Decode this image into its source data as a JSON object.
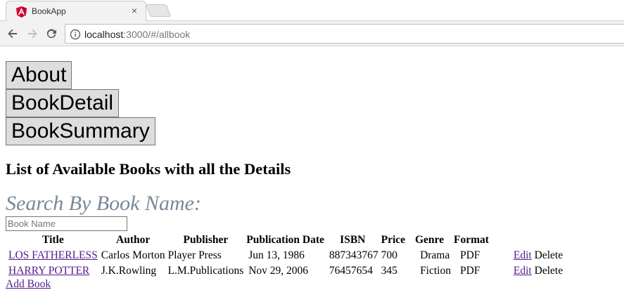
{
  "browser": {
    "tab_title": "BookApp",
    "url_host": "localhost",
    "url_path": ":3000/#/allbook",
    "icons": {
      "favicon": "angular-logo-icon",
      "close": "close-icon",
      "back": "back-arrow-icon",
      "forward": "forward-arrow-icon",
      "reload": "reload-icon",
      "site_info": "info-icon"
    },
    "tab_close_glyph": "×"
  },
  "nav": {
    "about_label": "About",
    "book_detail_label": "BookDetail",
    "book_summary_label": "BookSummary"
  },
  "page": {
    "heading": "List of Available Books with all the Details",
    "search_label": "Search By Book Name:",
    "search_placeholder": "Book Name",
    "search_value": ""
  },
  "table": {
    "headers": [
      "Title",
      "Author",
      "Publisher",
      "Publication Date",
      "ISBN",
      "Price",
      "Genre",
      "Format",
      ""
    ],
    "rows": [
      {
        "title": "LOS FATHERLESS",
        "author": "Carlos Morton",
        "publisher": "Player Press",
        "publication_date": "Jun 13, 1986",
        "isbn": "887343767",
        "price": "700",
        "genre": "Drama",
        "format": "PDF",
        "edit_label": "Edit",
        "delete_label": "Delete"
      },
      {
        "title": "HARRY POTTER",
        "author": "J.K.Rowling",
        "publisher": "L.M.Publications",
        "publication_date": "Nov 29, 2006",
        "isbn": "76457654",
        "price": "345",
        "genre": "Fiction",
        "format": "PDF",
        "edit_label": "Edit",
        "delete_label": "Delete"
      }
    ]
  },
  "add_book_label": "Add Book",
  "colors": {
    "search_label": "#778899",
    "link": "#551a8b",
    "angular_red": "#dd0031"
  }
}
